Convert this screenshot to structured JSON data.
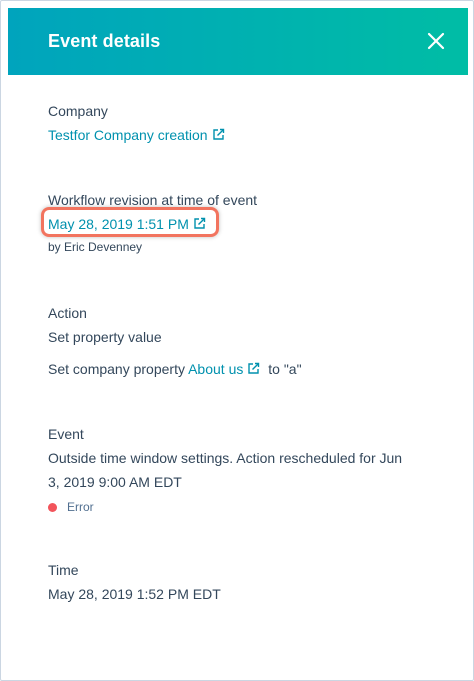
{
  "header": {
    "title": "Event details"
  },
  "company": {
    "label": "Company",
    "link_text": "Testfor Company creation"
  },
  "workflow": {
    "label": "Workflow revision at time of event",
    "link_text": "May 28, 2019 1:51 PM",
    "by_text": "by Eric Devenney"
  },
  "action": {
    "label": "Action",
    "title": "Set property value",
    "desc_prefix": "Set company property",
    "property_link": "About us",
    "desc_suffix": "to \"a\""
  },
  "event": {
    "label": "Event",
    "description_line1": "Outside time window settings. Action rescheduled for Jun",
    "description_line2": "3, 2019 9:00 AM EDT",
    "status": "Error",
    "status_color": "#f2545b"
  },
  "time": {
    "label": "Time",
    "value": "May 28, 2019 1:52 PM EDT"
  },
  "colors": {
    "header_gradient_start": "#00a4bd",
    "header_gradient_end": "#00bda5",
    "link": "#0091ae",
    "highlight": "#f2745f"
  }
}
